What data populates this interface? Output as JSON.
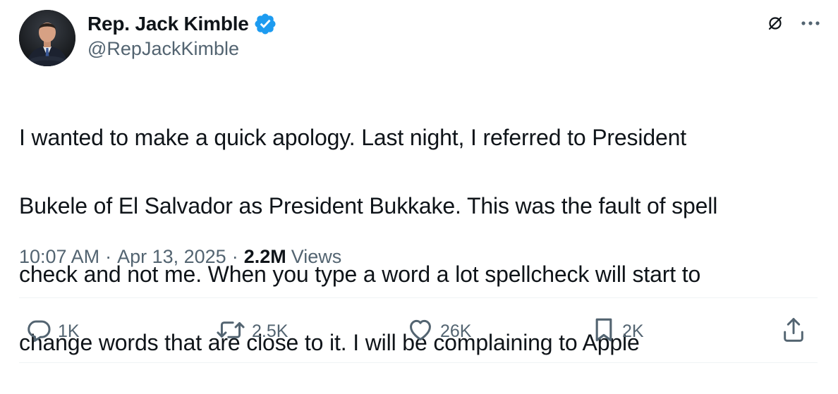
{
  "author": {
    "display_name": "Rep. Jack Kimble",
    "handle": "@RepJackKimble",
    "verified": true,
    "verified_color": "#1d9bf0"
  },
  "tweet": {
    "text_lines": [
      "I wanted to make a quick apology. Last night, I referred to President",
      "Bukele of El Salvador as President Bukkake. This was the fault of spell",
      "check and not me. When you type a word a lot spellcheck will start to",
      "change words that are close to it. I will be complaining to Apple"
    ],
    "time": "10:07 AM",
    "date": "Apr 13, 2025",
    "separator": "·",
    "views_count": "2.2M",
    "views_label": "Views"
  },
  "header_icons": {
    "grok": "grok-icon",
    "more": "more-options-icon"
  },
  "actions": {
    "reply": {
      "icon": "reply-icon",
      "count": "1K"
    },
    "repost": {
      "icon": "repost-icon",
      "count": "2.5K"
    },
    "like": {
      "icon": "heart-icon",
      "count": "26K"
    },
    "bookmark": {
      "icon": "bookmark-icon",
      "count": "2K"
    },
    "share": {
      "icon": "share-icon"
    }
  },
  "colors": {
    "text": "#0f1419",
    "secondary": "#536471",
    "divider": "#eff3f4",
    "verified": "#1d9bf0"
  }
}
